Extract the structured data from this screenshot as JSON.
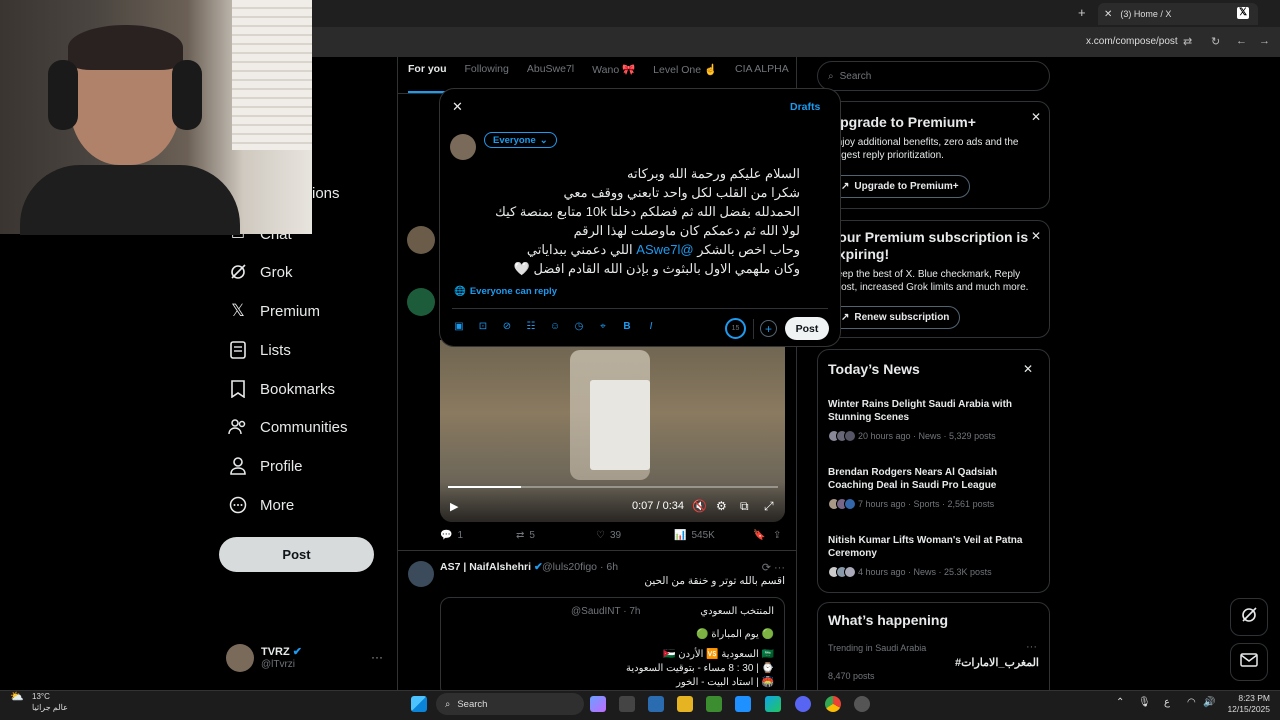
{
  "browser": {
    "tab_title": "(3) Home / X",
    "url": "x.com/compose/post"
  },
  "sidebar": {
    "items": [
      {
        "label": "ions",
        "icon": "notifications-icon"
      },
      {
        "label": "Chat",
        "icon": "chat-icon"
      },
      {
        "label": "Grok",
        "icon": "grok-icon"
      },
      {
        "label": "Premium",
        "icon": "x-logo-icon"
      },
      {
        "label": "Lists",
        "icon": "lists-icon"
      },
      {
        "label": "Bookmarks",
        "icon": "bookmark-icon"
      },
      {
        "label": "Communities",
        "icon": "communities-icon"
      },
      {
        "label": "Profile",
        "icon": "profile-icon"
      },
      {
        "label": "More",
        "icon": "more-icon"
      }
    ],
    "post_label": "Post",
    "account": {
      "name": "TVRZ",
      "handle": "@lTvrzi"
    }
  },
  "feed": {
    "tabs": [
      "For you",
      "Following",
      "AbuSwe7l",
      "Wano 🎀",
      "Level One ☝️",
      "CIA ALPHA"
    ],
    "video": {
      "time": "0:07 / 0:34"
    },
    "actions": {
      "replies": "1",
      "reposts": "5",
      "likes": "39",
      "views": "545K"
    },
    "tweet2": {
      "name": "AS7 | NaifAlshehri",
      "handle": "@luls20figo · 6h",
      "text": "اقسم بالله توتر و خنقة من الحين",
      "quote": {
        "name": "المنتخب السعودي",
        "handle": "@SaudINT · 7h",
        "lines": [
          "🟢 يوم المباراة 🟢",
          "🇸🇦 السعودية 🆚 الأردن 🇯🇴",
          "⌚ | 30 : 8 مساء - بتوقيت السعودية",
          "🏟️ | استاد البيت - الخور"
        ]
      }
    }
  },
  "compose": {
    "drafts": "Drafts",
    "audience": "Everyone",
    "lines": [
      "السلام عليكم ورحمة الله وبركاته",
      "شكرا من القلب لكل واحد تابعني ووقف معي",
      "الحمدلله بفضل الله ثم فضلكم دخلنا 10k متابع بمنصة كيك",
      "لولا الله ثم دعمكم كان ماوصلت لهذا الرقم",
      "وحاب اخص بالشكر ",
      "وكان ملهمي الاول بالبثوث و بإذن الله القادم افضل 🤍"
    ],
    "mention": "@ASwe7l",
    "line5_tail": " اللي دعمني ببداياتي",
    "reply_setting": "Everyone can reply",
    "char_counter": "15",
    "post_label": "Post"
  },
  "right": {
    "search_placeholder": "Search",
    "premium_card": {
      "title": "Upgrade to Premium+",
      "desc": "Enjoy additional benefits, zero ads and the largest reply prioritization.",
      "button": "Upgrade to Premium+"
    },
    "expiring_card": {
      "title": "Your Premium subscription is expiring!",
      "desc": "Keep the best of X. Blue checkmark, Reply boost, increased Grok limits and much more.",
      "button": "Renew subscription"
    },
    "news": {
      "title": "Today’s News",
      "items": [
        {
          "headline": "Winter Rains Delight Saudi Arabia with Stunning Scenes",
          "meta": "20 hours ago · News · 5,329 posts"
        },
        {
          "headline": "Brendan Rodgers Nears Al Qadsiah Coaching Deal in Saudi Pro League",
          "meta": "7 hours ago · Sports · 2,561 posts"
        },
        {
          "headline": "Nitish Kumar Lifts Woman's Veil at Patna Ceremony",
          "meta": "4 hours ago · News · 25.3K posts"
        }
      ]
    },
    "happening": {
      "title": "What’s happening",
      "context": "Trending in Saudi Arabia",
      "tag": "#المغرب_الامارات",
      "posts": "8,470 posts"
    }
  },
  "taskbar": {
    "weather_temp": "13°C",
    "weather_desc": "عالم جراثيا",
    "search": "Search",
    "time": "8:23 PM",
    "date": "12/15/2025",
    "lang": "ع"
  }
}
